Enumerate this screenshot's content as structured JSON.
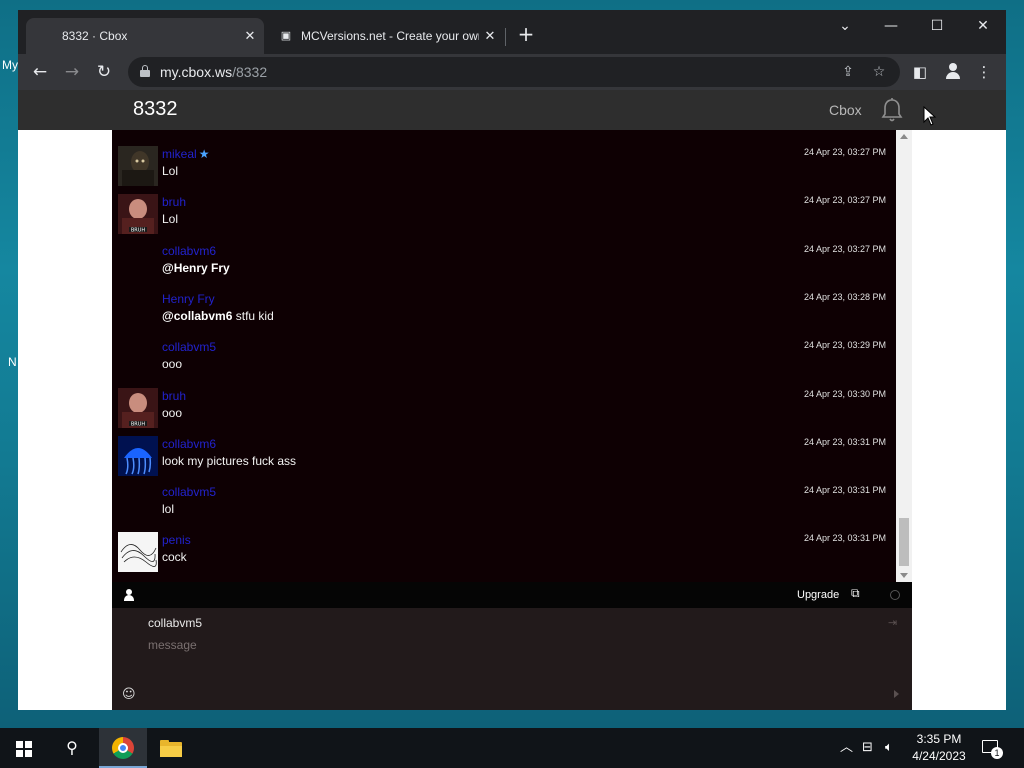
{
  "desktop": {
    "frag_my": "My",
    "frag_n": "N"
  },
  "browser": {
    "tabs": [
      {
        "title": "8332 · Cbox",
        "active": true
      },
      {
        "title": "MCVersions.net - Create your own",
        "active": false
      }
    ],
    "new_tab_label": "+",
    "address": {
      "host": "my.cbox.ws",
      "path": "/8332"
    },
    "controls": {
      "minimize": "—",
      "maximize": "☐",
      "close": "✕",
      "tab_search": "⌄"
    }
  },
  "site": {
    "title": "8332",
    "link": "Cbox"
  },
  "chat": {
    "messages": [
      {
        "user": "mikeal",
        "verified": true,
        "text": "Lol",
        "mention": "",
        "time": "24 Apr 23, 03:27 PM",
        "avatar": "dark"
      },
      {
        "user": "bruh",
        "verified": false,
        "text": "Lol",
        "mention": "",
        "time": "24 Apr 23, 03:27 PM",
        "avatar": "bruh"
      },
      {
        "user": "collabvm6",
        "verified": false,
        "text": "",
        "mention": "@Henry Fry",
        "time": "24 Apr 23, 03:27 PM",
        "avatar": "none"
      },
      {
        "user": "Henry Fry",
        "verified": false,
        "text": " stfu kid",
        "mention": "@collabvm6",
        "time": "24 Apr 23, 03:28 PM",
        "avatar": "none"
      },
      {
        "user": "collabvm5",
        "verified": false,
        "text": "ooo",
        "mention": "",
        "time": "24 Apr 23, 03:29 PM",
        "avatar": "none"
      },
      {
        "user": "bruh",
        "verified": false,
        "text": "ooo",
        "mention": "",
        "time": "24 Apr 23, 03:30 PM",
        "avatar": "bruh"
      },
      {
        "user": "collabvm6",
        "verified": false,
        "text": "look my pictures fuck ass",
        "mention": "",
        "time": "24 Apr 23, 03:31 PM",
        "avatar": "jelly"
      },
      {
        "user": "collabvm5",
        "verified": false,
        "text": "lol",
        "mention": "",
        "time": "24 Apr 23, 03:31 PM",
        "avatar": "none"
      },
      {
        "user": "penis",
        "verified": false,
        "text": "cock",
        "mention": "",
        "time": "24 Apr 23, 03:31 PM",
        "avatar": "sketch"
      }
    ],
    "bar": {
      "upgrade": "Upgrade"
    },
    "composer": {
      "name": "collabvm5",
      "placeholder": "message"
    }
  },
  "taskbar": {
    "time": "3:35 PM",
    "date": "4/24/2023",
    "notification_count": "1"
  }
}
